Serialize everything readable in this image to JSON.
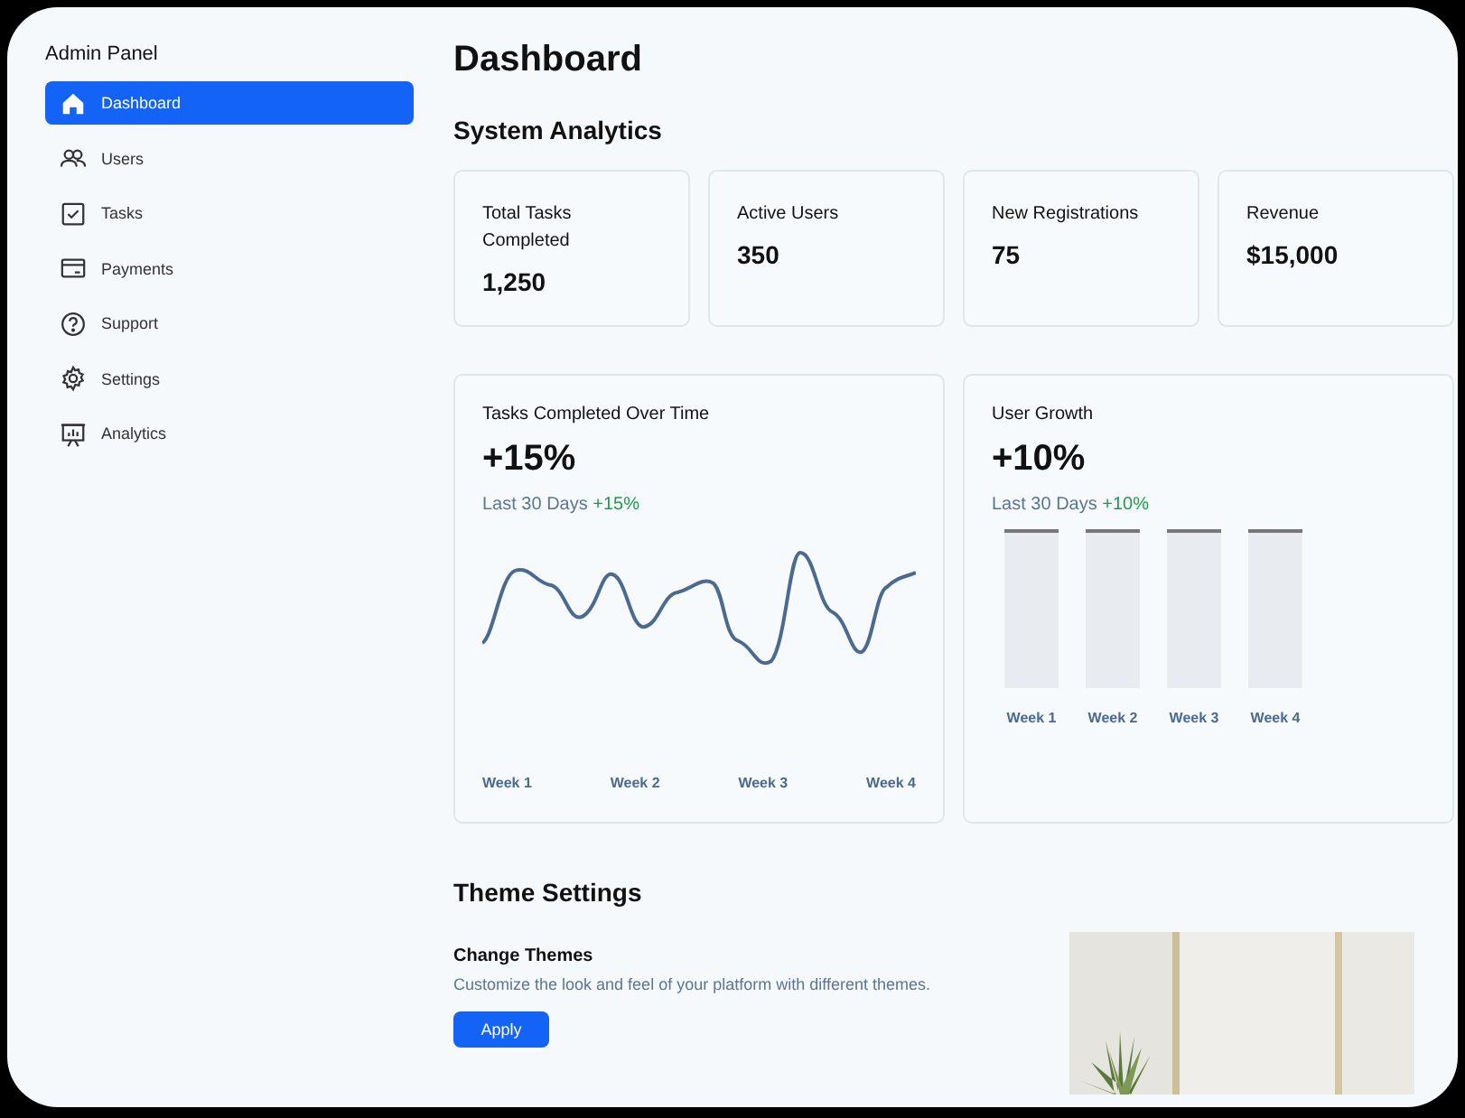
{
  "sidebar": {
    "title": "Admin Panel",
    "items": [
      {
        "label": "Dashboard",
        "kind": "home",
        "selected": true
      },
      {
        "label": "Users",
        "kind": "users",
        "selected": false
      },
      {
        "label": "Tasks",
        "kind": "tasks",
        "selected": false
      },
      {
        "label": "Payments",
        "kind": "card",
        "selected": false
      },
      {
        "label": "Support",
        "kind": "help",
        "selected": false
      },
      {
        "label": "Settings",
        "kind": "gear",
        "selected": false
      },
      {
        "label": "Analytics",
        "kind": "board",
        "selected": false
      }
    ]
  },
  "page_title": "Dashboard",
  "analytics": {
    "heading": "System Analytics",
    "stats": [
      {
        "label": "Total Tasks Completed",
        "value": "1,250"
      },
      {
        "label": "Active Users",
        "value": "350"
      },
      {
        "label": "New Registrations",
        "value": "75"
      },
      {
        "label": "Revenue",
        "value": "$15,000"
      }
    ]
  },
  "charts": [
    {
      "kind": "line",
      "title": "Tasks Completed Over Time",
      "value": "+15%",
      "period": "Last 30 Days",
      "change": "+15%",
      "labels": [
        "Week 1",
        "Week 2",
        "Week 3",
        "Week 4"
      ]
    },
    {
      "kind": "bar",
      "title": "User Growth",
      "value": "+10%",
      "period": "Last 30 Days",
      "change": "+10%",
      "labels": [
        "Week 1",
        "Week 2",
        "Week 3",
        "Week 4"
      ]
    }
  ],
  "theme": {
    "heading": "Theme Settings",
    "title": "Change Themes",
    "description": "Customize the look and feel of your platform with different themes.",
    "button": "Apply"
  }
}
